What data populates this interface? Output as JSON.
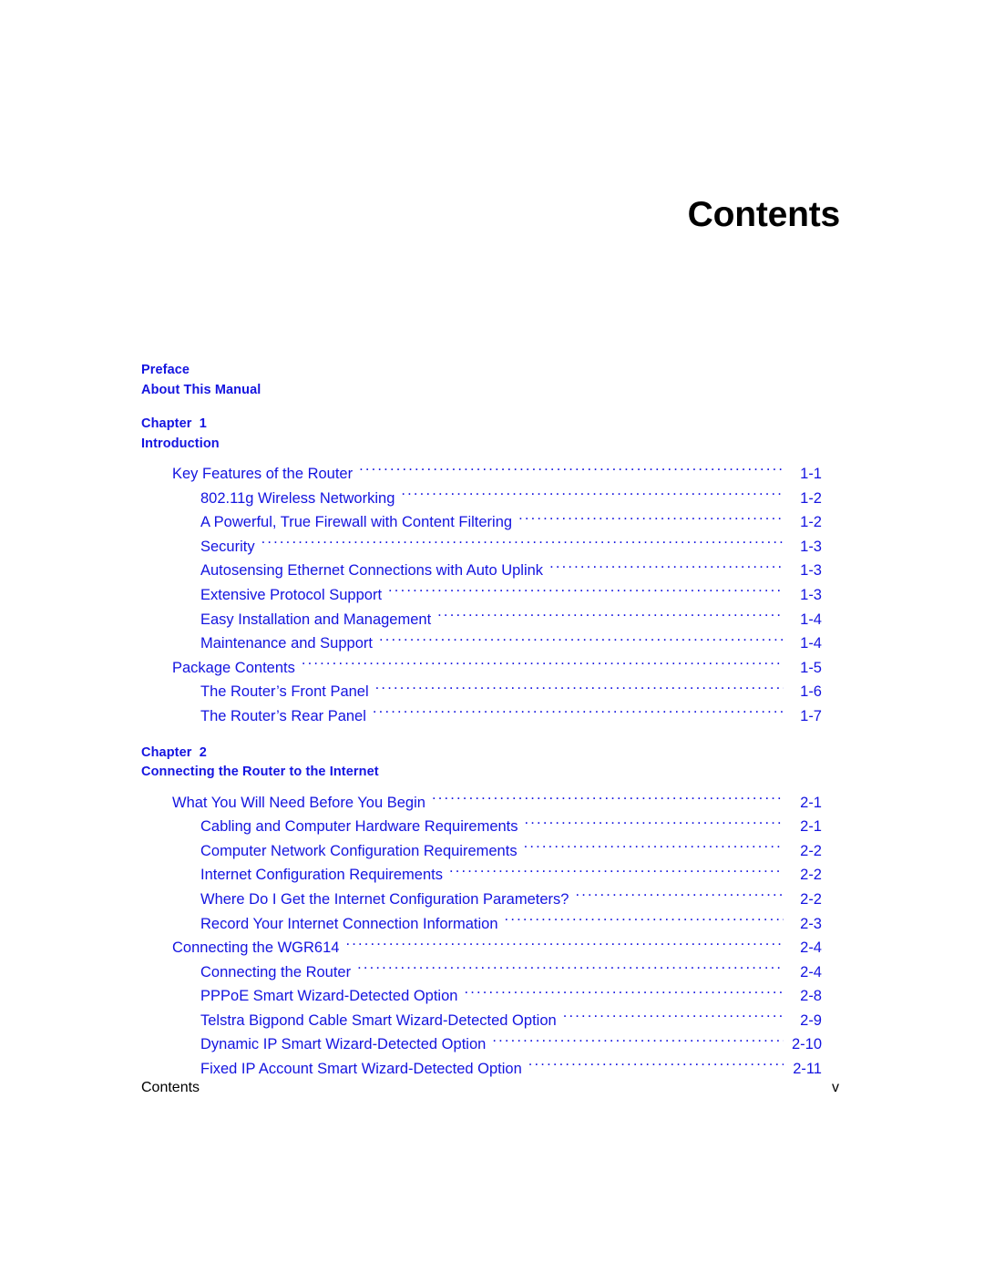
{
  "document": {
    "title": "Contents",
    "accent_color": "#1414e0",
    "text_color": "#000000",
    "background": "#ffffff"
  },
  "toc": {
    "sections": [
      {
        "heading_lines": [
          "Preface",
          "About This Manual"
        ],
        "entries": []
      },
      {
        "heading_lines": [
          "Chapter  1",
          "Introduction"
        ],
        "entries": [
          {
            "level": 1,
            "text": "Key Features of the Router",
            "page": "1-1"
          },
          {
            "level": 2,
            "text": "802.11g Wireless Networking",
            "page": "1-2"
          },
          {
            "level": 2,
            "text": "A Powerful, True Firewall with Content Filtering",
            "page": "1-2"
          },
          {
            "level": 2,
            "text": "Security",
            "page": "1-3"
          },
          {
            "level": 2,
            "text": "Autosensing Ethernet Connections with Auto Uplink",
            "page": "1-3"
          },
          {
            "level": 2,
            "text": "Extensive Protocol Support",
            "page": "1-3"
          },
          {
            "level": 2,
            "text": "Easy Installation and Management",
            "page": "1-4"
          },
          {
            "level": 2,
            "text": "Maintenance and Support",
            "page": "1-4"
          },
          {
            "level": 1,
            "text": "Package Contents",
            "page": "1-5"
          },
          {
            "level": 2,
            "text": "The Router’s Front Panel",
            "page": "1-6"
          },
          {
            "level": 2,
            "text": "The Router’s Rear Panel",
            "page": "1-7"
          }
        ]
      },
      {
        "heading_lines": [
          "Chapter  2",
          "Connecting the Router to the Internet"
        ],
        "entries": [
          {
            "level": 1,
            "text": "What You Will Need Before You Begin",
            "page": "2-1"
          },
          {
            "level": 2,
            "text": "Cabling and Computer Hardware Requirements",
            "page": "2-1"
          },
          {
            "level": 2,
            "text": "Computer Network Configuration Requirements",
            "page": "2-2"
          },
          {
            "level": 2,
            "text": "Internet Configuration Requirements",
            "page": "2-2"
          },
          {
            "level": 2,
            "text": "Where Do I Get the Internet Configuration Parameters?",
            "page": "2-2"
          },
          {
            "level": 2,
            "text": "Record Your Internet Connection Information",
            "page": "2-3"
          },
          {
            "level": 1,
            "text": "Connecting the WGR614",
            "page": "2-4"
          },
          {
            "level": 2,
            "text": "Connecting the Router",
            "page": "2-4"
          },
          {
            "level": 2,
            "text": "PPPoE Smart Wizard-Detected Option",
            "page": "2-8"
          },
          {
            "level": 2,
            "text": "Telstra Bigpond Cable Smart Wizard-Detected Option",
            "page": "2-9"
          },
          {
            "level": 2,
            "text": "Dynamic IP Smart Wizard-Detected Option",
            "page": "2-10"
          },
          {
            "level": 2,
            "text": "Fixed IP Account Smart Wizard-Detected Option",
            "page": "2-11"
          }
        ]
      }
    ]
  },
  "footer": {
    "left": "Contents",
    "right": "v"
  }
}
